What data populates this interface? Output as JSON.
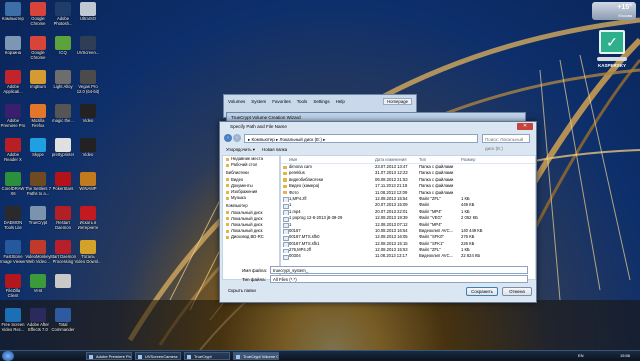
{
  "desktop_icons": [
    {
      "name": "Компьютер",
      "col": 0,
      "row": 0,
      "color": "#3d6ea8"
    },
    {
      "name": "Google\nChrome",
      "col": 1,
      "row": 0,
      "color": "#d9443a"
    },
    {
      "name": "Adobe\nPhotosh...",
      "col": 2,
      "row": 0,
      "color": "#1f3d69"
    },
    {
      "name": "UltraISO",
      "col": 3,
      "row": 0,
      "color": "#c0c8d4"
    },
    {
      "name": "Корзина",
      "col": 0,
      "row": 1,
      "color": "#7d96b3"
    },
    {
      "name": "Google\nChrome",
      "col": 1,
      "row": 1,
      "color": "#d9443a"
    },
    {
      "name": "ICQ",
      "col": 2,
      "row": 1,
      "color": "#5da33c"
    },
    {
      "name": "UVScreen...",
      "col": 3,
      "row": 1,
      "color": "#2f3d55"
    },
    {
      "name": "Adobe\nApplicati...",
      "col": 0,
      "row": 2,
      "color": "#c1242a"
    },
    {
      "name": "ImgBurn",
      "col": 1,
      "row": 2,
      "color": "#d59b32"
    },
    {
      "name": "Light Alloy",
      "col": 2,
      "row": 2,
      "color": "#6d6d6d"
    },
    {
      "name": "Vegas Pro\n12.0 (64-bit)",
      "col": 3,
      "row": 2,
      "color": "#4b4b4b"
    },
    {
      "name": "Adobe\nPremiere Pro",
      "col": 0,
      "row": 3,
      "color": "#3a1f6e"
    },
    {
      "name": "Mozilla\nFirefox",
      "col": 1,
      "row": 3,
      "color": "#e2762a"
    },
    {
      "name": "magic the...",
      "col": 2,
      "row": 3,
      "color": "#555555"
    },
    {
      "name": "Video",
      "col": 3,
      "row": 3,
      "color": "#222222"
    },
    {
      "name": "Adobe\nReader X",
      "col": 0,
      "row": 4,
      "color": "#b81f24"
    },
    {
      "name": "Skype",
      "col": 1,
      "row": 4,
      "color": "#1ea0e3"
    },
    {
      "name": "prettyprinter",
      "col": 2,
      "row": 4,
      "color": "#e0e0e0"
    },
    {
      "name": "Video",
      "col": 3,
      "row": 4,
      "color": "#222222"
    },
    {
      "name": "CorelDRAW\nX6",
      "col": 0,
      "row": 5,
      "color": "#2b8f3c"
    },
    {
      "name": "The Settlers 7\nPaths to a...",
      "col": 1,
      "row": 5,
      "color": "#6f4a21"
    },
    {
      "name": "PokerStars",
      "col": 2,
      "row": 5,
      "color": "#b3121a"
    },
    {
      "name": "WINAMP",
      "col": 3,
      "row": 5,
      "color": "#c27a1d"
    },
    {
      "name": "DAEMON\nTools Lite",
      "col": 0,
      "row": 6,
      "color": "#2a2a2a"
    },
    {
      "name": "TrueCrypt",
      "col": 1,
      "row": 6,
      "color": "#7c93ad"
    },
    {
      "name": "Restart\nDaemon",
      "col": 2,
      "row": 6,
      "color": "#b21f25"
    },
    {
      "name": "Искать в\nИнтернете",
      "col": 3,
      "row": 6,
      "color": "#c21a20"
    },
    {
      "name": "FastStone\nImage Viewer",
      "col": 0,
      "row": 7,
      "color": "#26589e"
    },
    {
      "name": "VideoMonkey\nWeb Video...",
      "col": 1,
      "row": 7,
      "color": "#c0392b"
    },
    {
      "name": "Start Daemon\nProcessing",
      "col": 2,
      "row": 7,
      "color": "#b7202a"
    },
    {
      "name": "Тоталь\nVideo Downl...",
      "col": 3,
      "row": 7,
      "color": "#d3a229"
    },
    {
      "name": "FileZilla\nClient",
      "col": 0,
      "row": 8,
      "color": "#b3171d"
    },
    {
      "name": "Vent",
      "col": 1,
      "row": 8,
      "color": "#3b9a3a"
    },
    {
      "name": "",
      "col": 2,
      "row": 8,
      "color": "#c9c9c9"
    },
    {
      "name": "Free Screen\nVideo Rec...",
      "col": 0,
      "row": 9,
      "color": "#1b6fb7"
    },
    {
      "name": "Adobe After\nEffects 7.0",
      "col": 1,
      "row": 9,
      "color": "#2c2a5c"
    },
    {
      "name": "Total\nCommander",
      "col": 2,
      "row": 9,
      "color": "#2d5aa0"
    }
  ],
  "gadgets": {
    "weather_temp": "+15°",
    "weather_city": "Москва",
    "kaspersky_label": "KASPERSKY"
  },
  "truecrypt_window": {
    "menu": [
      "Volumes",
      "System",
      "Favorites",
      "Tools",
      "Settings",
      "Help"
    ],
    "homepage": "Homepage"
  },
  "wizard_title": "TrueCrypt Volume Creation Wizard",
  "dialog": {
    "title": "Specify Path and File Name",
    "close_glyph": "✕",
    "address": "▸ Компьютер ▸ Локальный диск (E:) ▸",
    "search_placeholder": "Поиск: Локальный диск (E:)",
    "organize": "Упорядочить ▾",
    "new_folder": "Новая папка",
    "nav_items": [
      {
        "label": "Недавние места",
        "group": false
      },
      {
        "label": "Рабочий стол",
        "group": false
      },
      {
        "label": "Библиотеки",
        "group": true
      },
      {
        "label": "Видео",
        "group": false
      },
      {
        "label": "Документы",
        "group": false
      },
      {
        "label": "Изображения",
        "group": false
      },
      {
        "label": "Музыка",
        "group": false
      },
      {
        "label": "Компьютер",
        "group": true
      },
      {
        "label": "Локальный диск",
        "group": false
      },
      {
        "label": "Локальный диск",
        "group": false
      },
      {
        "label": "Локальный диск",
        "group": false
      },
      {
        "label": "Локальный диск",
        "group": false
      },
      {
        "label": "Дисковод BD-RC",
        "group": false
      }
    ],
    "columns": [
      "Имя",
      "Дата изменения",
      "Тип",
      "Размер"
    ],
    "files": [
      {
        "name": "dimona cam",
        "date": "23.07.2013 13:47",
        "type": "Папка с файлами",
        "size": "",
        "kind": "folder"
      },
      {
        "name": "pereklus",
        "date": "31.07.2013 12:23",
        "type": "Папка с файлами",
        "size": "",
        "kind": "folder"
      },
      {
        "name": "видеобиблиотеки",
        "date": "06.08.2013 21:53",
        "type": "Папка с файлами",
        "size": "",
        "kind": "folder"
      },
      {
        "name": "Видео (камера)",
        "date": "17.11.2013 21:18",
        "type": "Папка с файлами",
        "size": "",
        "kind": "folder"
      },
      {
        "name": "Фото",
        "date": "11.08.2013 12:09",
        "type": "Папка с файлами",
        "size": "",
        "kind": "folder"
      },
      {
        "name": "1,MP4.zfl",
        "date": "12.08.2013 15:54",
        "type": "Файл \"ZFL\"",
        "size": "1 КБ",
        "kind": "file"
      },
      {
        "name": "1",
        "date": "20.07.2013 15:09",
        "type": "Файл",
        "size": "449 КБ",
        "kind": "file"
      },
      {
        "name": "1.mp4",
        "date": "20.07.2013 22:01",
        "type": "Файл \"MP4\"",
        "size": "1 КБ",
        "kind": "file"
      },
      {
        "name": "1 poprog 12-8-2013 j8-39-29",
        "date": "12.08.2013 19:39",
        "type": "Файл \"VEG\"",
        "size": "2 052 КБ",
        "kind": "file"
      },
      {
        "name": "1",
        "date": "12.08.2013 07:12",
        "type": "Файл \"MP4\"",
        "size": "",
        "kind": "file"
      },
      {
        "name": "00187",
        "date": "10.08.2013 16:54",
        "type": "Видеоклип AVC...",
        "size": "140 449 КБ",
        "kind": "file"
      },
      {
        "name": "00187.MTS.sfk0",
        "date": "12.08.2013 16:05",
        "type": "Файл \"SFK0\"",
        "size": "276 КБ",
        "kind": "file"
      },
      {
        "name": "00187.MTS.sfk1",
        "date": "12.08.2013 15:15",
        "type": "Файл \"SFK1\"",
        "size": "226 КБ",
        "kind": "file"
      },
      {
        "name": "276,MP4.zfl",
        "date": "12.08.2013 15:53",
        "type": "Файл \"ZFL\"",
        "size": "1 КБ",
        "kind": "file"
      },
      {
        "name": "00304",
        "date": "11.08.2013 13:17",
        "type": "Видеоклип AVC...",
        "size": "22 824 КБ",
        "kind": "file"
      }
    ],
    "filename_label": "Имя файла:",
    "filename_value": "truecrypt_system_",
    "filetype_label": "Тип файла:",
    "filetype_value": "All Files (*.*)",
    "hide_folders": "Скрыть папки",
    "save_button": "Сохранить",
    "cancel_button": "Отмена"
  },
  "taskbar": {
    "buttons": [
      "Adobe Premiere Pro ...",
      "UVScreenCamera",
      "TrueCrypt",
      "TrueCrypt Volume Cre..."
    ],
    "lang": "EN",
    "time": "15:56"
  },
  "colors": {
    "accent": "#4a7fc2",
    "folder": "#e2b545",
    "close": "#c8433b"
  }
}
